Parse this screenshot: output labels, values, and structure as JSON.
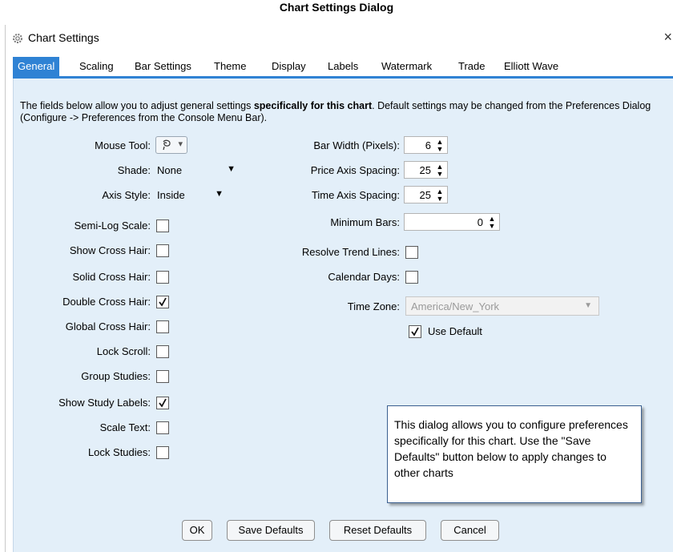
{
  "caption": "Chart Settings Dialog",
  "window": {
    "title": "Chart Settings",
    "close_glyph": "×",
    "app_icon": "gear-icon"
  },
  "tabs": [
    {
      "label": "General",
      "active": true
    },
    {
      "label": "Scaling"
    },
    {
      "label": "Bar Settings"
    },
    {
      "label": "Theme"
    },
    {
      "label": "Display"
    },
    {
      "label": "Labels"
    },
    {
      "label": "Watermark"
    },
    {
      "label": "Trade"
    },
    {
      "label": "Elliott Wave"
    }
  ],
  "description": {
    "part1": "The fields below allow you to adjust general settings ",
    "bold": "specifically for this chart",
    "part2": ". Default settings may be changed from the Preferences Dialog (Configure -> Preferences from the Console Menu Bar)."
  },
  "left": {
    "mouse_tool": {
      "label": "Mouse Tool:",
      "icon": "lasso-icon",
      "arrow": "▾"
    },
    "shade": {
      "label": "Shade:",
      "value": "None",
      "arrow": "▼"
    },
    "axis_style": {
      "label": "Axis Style:",
      "value": "Inside",
      "arrow": "▼"
    },
    "checkboxes": [
      {
        "label": "Semi-Log Scale:",
        "checked": false
      },
      {
        "label": "Show Cross Hair:",
        "checked": false
      },
      {
        "label": "Solid Cross Hair:",
        "checked": false
      },
      {
        "label": "Double Cross Hair:",
        "checked": true
      },
      {
        "label": "Global Cross Hair:",
        "checked": false
      },
      {
        "label": "Lock Scroll:",
        "checked": false
      },
      {
        "label": "Group Studies:",
        "checked": false
      },
      {
        "label": "Show Study Labels:",
        "checked": true
      },
      {
        "label": "Scale Text:",
        "checked": false
      },
      {
        "label": "Lock Studies:",
        "checked": false
      }
    ]
  },
  "right": {
    "bar_width": {
      "label": "Bar Width (Pixels):",
      "value": "6"
    },
    "price_axis_spacing": {
      "label": "Price Axis Spacing:",
      "value": "25"
    },
    "time_axis_spacing": {
      "label": "Time Axis Spacing:",
      "value": "25"
    },
    "minimum_bars": {
      "label": "Minimum Bars:",
      "value": "0"
    },
    "resolve_trend_lines": {
      "label": "Resolve Trend Lines:",
      "checked": false
    },
    "calendar_days": {
      "label": "Calendar Days:",
      "checked": false
    },
    "time_zone": {
      "label": "Time Zone:",
      "value": "America/New_York",
      "arrow": "▼"
    },
    "use_default": {
      "label": "Use Default",
      "checked": true
    }
  },
  "spinner_arrows": "▲▼",
  "callout": "This dialog allows you to configure preferences specifically for this chart. Use the \"Save Defaults\" button below to apply changes to other charts",
  "buttons": {
    "ok": "OK",
    "save_defaults": "Save Defaults",
    "reset_defaults": "Reset Defaults",
    "cancel": "Cancel"
  },
  "colors": {
    "accent": "#2f82d4",
    "panel_bg": "#e3eff9"
  }
}
